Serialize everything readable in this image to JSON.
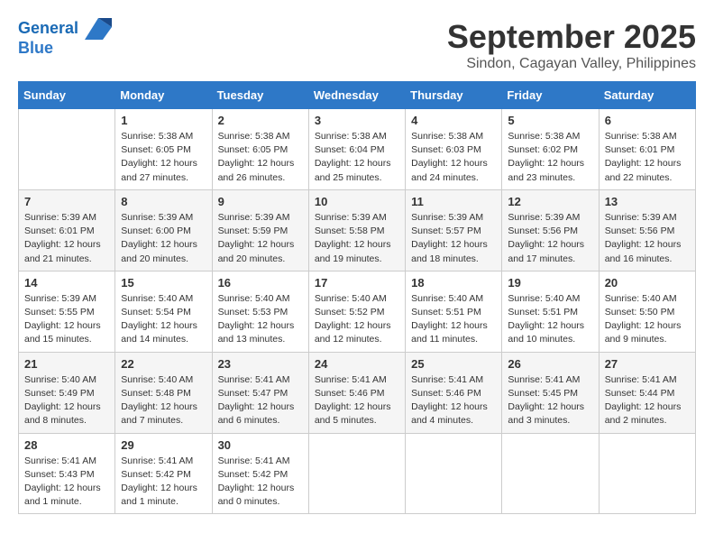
{
  "header": {
    "logo_line1": "General",
    "logo_line2": "Blue",
    "month": "September 2025",
    "location": "Sindon, Cagayan Valley, Philippines"
  },
  "weekdays": [
    "Sunday",
    "Monday",
    "Tuesday",
    "Wednesday",
    "Thursday",
    "Friday",
    "Saturday"
  ],
  "weeks": [
    [
      {
        "day": "",
        "info": ""
      },
      {
        "day": "1",
        "info": "Sunrise: 5:38 AM\nSunset: 6:05 PM\nDaylight: 12 hours\nand 27 minutes."
      },
      {
        "day": "2",
        "info": "Sunrise: 5:38 AM\nSunset: 6:05 PM\nDaylight: 12 hours\nand 26 minutes."
      },
      {
        "day": "3",
        "info": "Sunrise: 5:38 AM\nSunset: 6:04 PM\nDaylight: 12 hours\nand 25 minutes."
      },
      {
        "day": "4",
        "info": "Sunrise: 5:38 AM\nSunset: 6:03 PM\nDaylight: 12 hours\nand 24 minutes."
      },
      {
        "day": "5",
        "info": "Sunrise: 5:38 AM\nSunset: 6:02 PM\nDaylight: 12 hours\nand 23 minutes."
      },
      {
        "day": "6",
        "info": "Sunrise: 5:38 AM\nSunset: 6:01 PM\nDaylight: 12 hours\nand 22 minutes."
      }
    ],
    [
      {
        "day": "7",
        "info": "Sunrise: 5:39 AM\nSunset: 6:01 PM\nDaylight: 12 hours\nand 21 minutes."
      },
      {
        "day": "8",
        "info": "Sunrise: 5:39 AM\nSunset: 6:00 PM\nDaylight: 12 hours\nand 20 minutes."
      },
      {
        "day": "9",
        "info": "Sunrise: 5:39 AM\nSunset: 5:59 PM\nDaylight: 12 hours\nand 20 minutes."
      },
      {
        "day": "10",
        "info": "Sunrise: 5:39 AM\nSunset: 5:58 PM\nDaylight: 12 hours\nand 19 minutes."
      },
      {
        "day": "11",
        "info": "Sunrise: 5:39 AM\nSunset: 5:57 PM\nDaylight: 12 hours\nand 18 minutes."
      },
      {
        "day": "12",
        "info": "Sunrise: 5:39 AM\nSunset: 5:56 PM\nDaylight: 12 hours\nand 17 minutes."
      },
      {
        "day": "13",
        "info": "Sunrise: 5:39 AM\nSunset: 5:56 PM\nDaylight: 12 hours\nand 16 minutes."
      }
    ],
    [
      {
        "day": "14",
        "info": "Sunrise: 5:39 AM\nSunset: 5:55 PM\nDaylight: 12 hours\nand 15 minutes."
      },
      {
        "day": "15",
        "info": "Sunrise: 5:40 AM\nSunset: 5:54 PM\nDaylight: 12 hours\nand 14 minutes."
      },
      {
        "day": "16",
        "info": "Sunrise: 5:40 AM\nSunset: 5:53 PM\nDaylight: 12 hours\nand 13 minutes."
      },
      {
        "day": "17",
        "info": "Sunrise: 5:40 AM\nSunset: 5:52 PM\nDaylight: 12 hours\nand 12 minutes."
      },
      {
        "day": "18",
        "info": "Sunrise: 5:40 AM\nSunset: 5:51 PM\nDaylight: 12 hours\nand 11 minutes."
      },
      {
        "day": "19",
        "info": "Sunrise: 5:40 AM\nSunset: 5:51 PM\nDaylight: 12 hours\nand 10 minutes."
      },
      {
        "day": "20",
        "info": "Sunrise: 5:40 AM\nSunset: 5:50 PM\nDaylight: 12 hours\nand 9 minutes."
      }
    ],
    [
      {
        "day": "21",
        "info": "Sunrise: 5:40 AM\nSunset: 5:49 PM\nDaylight: 12 hours\nand 8 minutes."
      },
      {
        "day": "22",
        "info": "Sunrise: 5:40 AM\nSunset: 5:48 PM\nDaylight: 12 hours\nand 7 minutes."
      },
      {
        "day": "23",
        "info": "Sunrise: 5:41 AM\nSunset: 5:47 PM\nDaylight: 12 hours\nand 6 minutes."
      },
      {
        "day": "24",
        "info": "Sunrise: 5:41 AM\nSunset: 5:46 PM\nDaylight: 12 hours\nand 5 minutes."
      },
      {
        "day": "25",
        "info": "Sunrise: 5:41 AM\nSunset: 5:46 PM\nDaylight: 12 hours\nand 4 minutes."
      },
      {
        "day": "26",
        "info": "Sunrise: 5:41 AM\nSunset: 5:45 PM\nDaylight: 12 hours\nand 3 minutes."
      },
      {
        "day": "27",
        "info": "Sunrise: 5:41 AM\nSunset: 5:44 PM\nDaylight: 12 hours\nand 2 minutes."
      }
    ],
    [
      {
        "day": "28",
        "info": "Sunrise: 5:41 AM\nSunset: 5:43 PM\nDaylight: 12 hours\nand 1 minute."
      },
      {
        "day": "29",
        "info": "Sunrise: 5:41 AM\nSunset: 5:42 PM\nDaylight: 12 hours\nand 1 minute."
      },
      {
        "day": "30",
        "info": "Sunrise: 5:41 AM\nSunset: 5:42 PM\nDaylight: 12 hours\nand 0 minutes."
      },
      {
        "day": "",
        "info": ""
      },
      {
        "day": "",
        "info": ""
      },
      {
        "day": "",
        "info": ""
      },
      {
        "day": "",
        "info": ""
      }
    ]
  ]
}
